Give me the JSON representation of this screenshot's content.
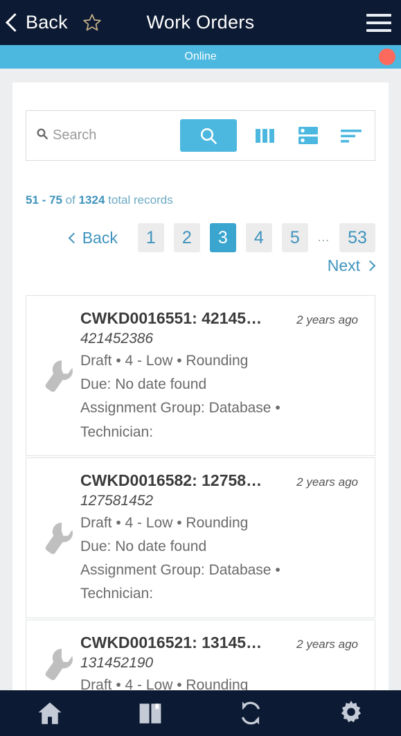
{
  "header": {
    "back_label": "Back",
    "title": "Work Orders",
    "star_icon": "star-outline-icon",
    "menu_icon": "hamburger-menu-icon"
  },
  "status": {
    "text": "Online",
    "indicator_color": "#fc6a5d",
    "bar_color": "#4cb8e0"
  },
  "search": {
    "placeholder": "Search",
    "value": "",
    "search_icon": "search-icon",
    "submit_icon": "magnifier-icon",
    "tools": [
      {
        "name": "columns-icon",
        "label": "Columns"
      },
      {
        "name": "list-view-icon",
        "label": "List view"
      },
      {
        "name": "sort-filter-icon",
        "label": "Sort"
      }
    ]
  },
  "records": {
    "range": "51 - 75",
    "of": "of",
    "total": "1324",
    "suffix": "total records"
  },
  "pagination": {
    "back_label": "Back",
    "next_label": "Next",
    "pages": [
      "1",
      "2",
      "3",
      "4",
      "5"
    ],
    "ellipsis": "...",
    "last_page": "53",
    "active_page": "3",
    "active_color": "#3aa5cf"
  },
  "list": [
    {
      "icon": "wrench-icon",
      "title": "CWKD0016551: 42145…",
      "time": "2 years ago",
      "subtitle": "421452386",
      "meta_line1": "Draft • 4 - Low • Rounding",
      "meta_line2": "Due: No date found",
      "meta_line3": "Assignment Group: Database •",
      "meta_line4": "Technician:"
    },
    {
      "icon": "wrench-icon",
      "title": "CWKD0016582: 12758…",
      "time": "2 years ago",
      "subtitle": "127581452",
      "meta_line1": "Draft • 4 - Low • Rounding",
      "meta_line2": "Due: No date found",
      "meta_line3": "Assignment Group: Database •",
      "meta_line4": "Technician:"
    },
    {
      "icon": "wrench-icon",
      "title": "CWKD0016521: 13145…",
      "time": "2 years ago",
      "subtitle": "131452190",
      "meta_line1": "Draft • 4 - Low • Rounding",
      "meta_line2": "",
      "meta_line3": "",
      "meta_line4": ""
    }
  ],
  "bottom_nav": [
    {
      "name": "home-icon",
      "label": "Home"
    },
    {
      "name": "book-icon",
      "label": "Catalog"
    },
    {
      "name": "sync-icon",
      "label": "Sync"
    },
    {
      "name": "settings-gear-icon",
      "label": "Settings"
    }
  ]
}
